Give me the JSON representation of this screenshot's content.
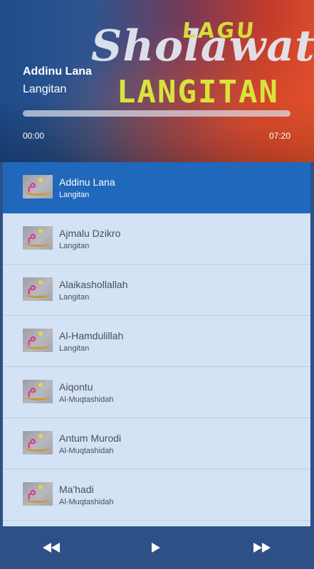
{
  "banner": {
    "art_lagu": "LAGU",
    "art_sholawat": "Sholawat",
    "art_langitan": "LANGITAN"
  },
  "now_playing": {
    "title": "Addinu Lana",
    "artist": "Langitan",
    "time_current": "00:00",
    "time_total": "07:20",
    "progress": 0.0
  },
  "playlist": [
    {
      "title": "Addinu Lana",
      "artist": "Langitan",
      "active": true
    },
    {
      "title": "Ajmalu Dzikro",
      "artist": "Langitan",
      "active": false
    },
    {
      "title": "Alaikashollallah",
      "artist": "Langitan",
      "active": false
    },
    {
      "title": "Al-Hamdulillah",
      "artist": "Langitan",
      "active": false
    },
    {
      "title": "Aiqontu",
      "artist": "Al-Muqtashidah",
      "active": false
    },
    {
      "title": "Antum Murodi",
      "artist": "Al-Muqtashidah",
      "active": false
    },
    {
      "title": "Ma'hadi",
      "artist": "Al-Muqtashidah",
      "active": false
    }
  ],
  "controls": {
    "prev_icon": "rewind-icon",
    "play_icon": "play-icon",
    "next_icon": "fast-forward-icon"
  },
  "colors": {
    "header_blue": "#1f4c8c",
    "header_red": "#c23a2c",
    "active_row": "#1f68bc",
    "list_bg": "#d3e2f4",
    "control_bar": "#2d5086",
    "art_yellow": "#d9e33a"
  }
}
